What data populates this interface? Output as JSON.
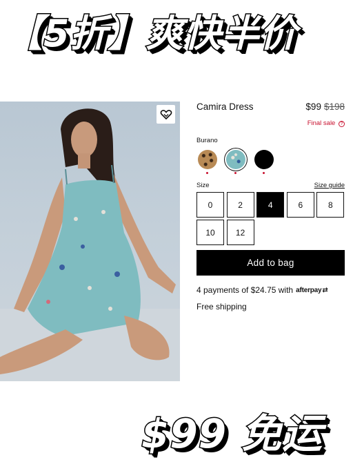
{
  "banner": {
    "top_text": "【5折】爽快半价",
    "bottom_text": "$99 免运"
  },
  "product": {
    "name": "Camira Dress",
    "price": "$99",
    "original_price": "$198",
    "final_sale_label": "Final sale",
    "color_label": "Burano",
    "swatches": [
      {
        "name": "leopard",
        "color": "#b88a55",
        "selected": false
      },
      {
        "name": "burano",
        "color": "#7fbcc0",
        "selected": true
      },
      {
        "name": "black",
        "color": "#000000",
        "selected": false
      }
    ],
    "size_label": "Size",
    "size_guide_label": "Size guide",
    "sizes": [
      "0",
      "2",
      "4",
      "6",
      "8",
      "10",
      "12"
    ],
    "selected_size": "4",
    "add_to_bag_label": "Add to bag",
    "installments_text": "4 payments of $24.75 with",
    "afterpay_label": "afterpay",
    "shipping_text": "Free shipping"
  },
  "colors": {
    "accent_red": "#c8102e",
    "button_black": "#000000"
  }
}
